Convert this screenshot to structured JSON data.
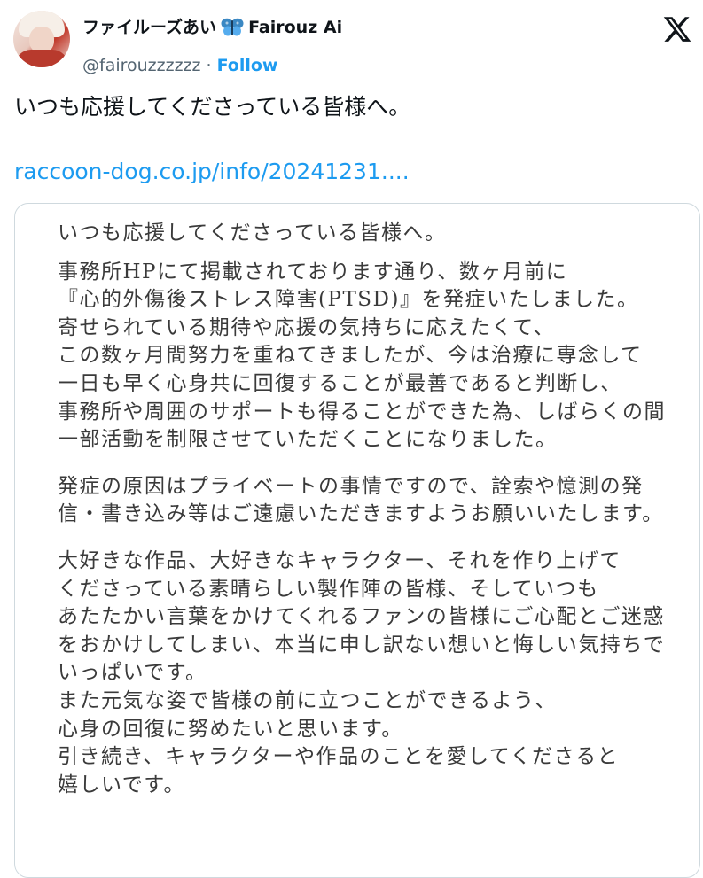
{
  "header": {
    "display_name_jp": "ファイルーズあい",
    "display_name_en": "Fairouz Ai",
    "handle": "@fairouzzzzzz",
    "separator": "·",
    "follow_label": "Follow"
  },
  "tweet": {
    "text": "いつも応援してくださっている皆様へ。",
    "link": "raccoon-dog.co.jp/info/20241231...."
  },
  "statement": {
    "title": "いつも応援してくださっている皆様へ。",
    "para1": [
      "事務所HPにて掲載されております通り、数ヶ月前に",
      "『心的外傷後ストレス障害(PTSD)』を発症いたしました。",
      "寄せられている期待や応援の気持ちに応えたくて、",
      "この数ヶ月間努力を重ねてきましたが、今は治療に専念して",
      "一日も早く心身共に回復することが最善であると判断し、",
      "事務所や周囲のサポートも得ることができた為、しばらくの間",
      "一部活動を制限させていただくことになりました。"
    ],
    "para2": [
      "発症の原因はプライベートの事情ですので、詮索や憶測の発",
      "信・書き込み等はご遠慮いただきますようお願いいたします。"
    ],
    "para3": [
      "大好きな作品、大好きなキャラクター、それを作り上げて",
      "くださっている素晴らしい製作陣の皆様、そしていつも",
      "あたたかい言葉をかけてくれるファンの皆様にご心配とご迷惑",
      "をおかけしてしまい、本当に申し訳ない想いと悔しい気持ちで",
      "いっぱいです。",
      "また元気な姿で皆様の前に立つことができるよう、",
      "心身の回復に努めたいと思います。",
      "引き続き、キャラクターや作品のことを愛してくださると",
      "嬉しいです。"
    ]
  },
  "icons": {
    "avatar": "avatar",
    "butterfly": "butterfly-emoji-icon",
    "x_logo": "x-logo-icon"
  },
  "colors": {
    "link": "#1d9bf0",
    "muted": "#536471",
    "text": "#0f1419",
    "border": "#cfd9de",
    "butterfly": "#3b88c3"
  }
}
